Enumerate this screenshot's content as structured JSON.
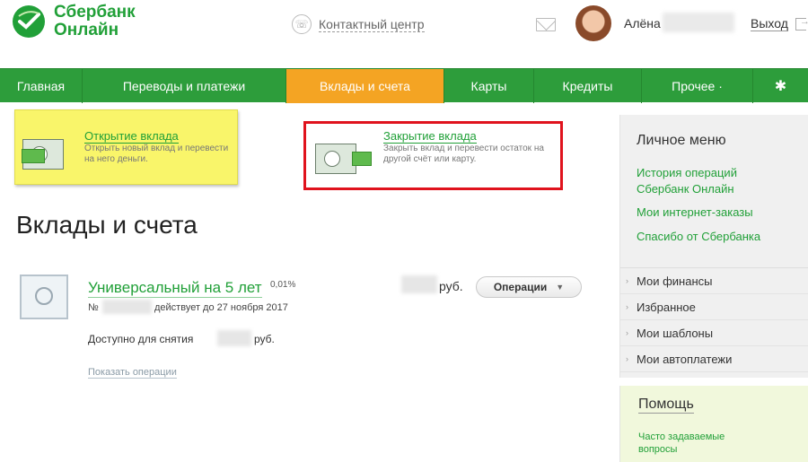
{
  "header": {
    "brand_line1": "Сбербанк",
    "brand_line2": "Онлайн",
    "contact_center": "Контактный центр",
    "user_name": "Алёна",
    "logout": "Выход"
  },
  "nav": {
    "items": [
      {
        "label": "Главная"
      },
      {
        "label": "Переводы и платежи"
      },
      {
        "label": "Вклады и счета"
      },
      {
        "label": "Карты"
      },
      {
        "label": "Кредиты"
      },
      {
        "label": "Прочее ·"
      }
    ],
    "active_index": 2
  },
  "tiles": {
    "open": {
      "title": "Открытие вклада",
      "description": "Открыть новый вклад и перевести на него деньги."
    },
    "close": {
      "title": "Закрытие вклада",
      "description": "Закрыть вклад и перевести остаток на другой счёт или карту."
    }
  },
  "main": {
    "page_title": "Вклады и счета",
    "account": {
      "name": "Универсальный на 5 лет",
      "rate": "0,01%",
      "number_prefix": "№",
      "valid_until": "действует до 27 ноября 2017",
      "available_label": "Доступно для снятия",
      "available_currency": "руб.",
      "balance_currency": "руб.",
      "operations_button": "Операции",
      "show_operations": "Показать операции"
    }
  },
  "sidebar": {
    "personal_menu_title": "Личное меню",
    "links": [
      "История операций Сбербанк Онлайн",
      "Мои интернет-заказы",
      "Спасибо от Сбербанка"
    ],
    "sections": [
      "Мои финансы",
      "Избранное",
      "Мои шаблоны",
      "Мои автоплатежи"
    ],
    "help_title": "Помощь",
    "help_link": "Часто задаваемые вопросы"
  },
  "colors": {
    "brand_green": "#21a038",
    "nav_green": "#2d9d3b",
    "nav_active": "#f4a423",
    "highlight_tile": "#f9f56a",
    "annotation_red": "#e0131d"
  }
}
